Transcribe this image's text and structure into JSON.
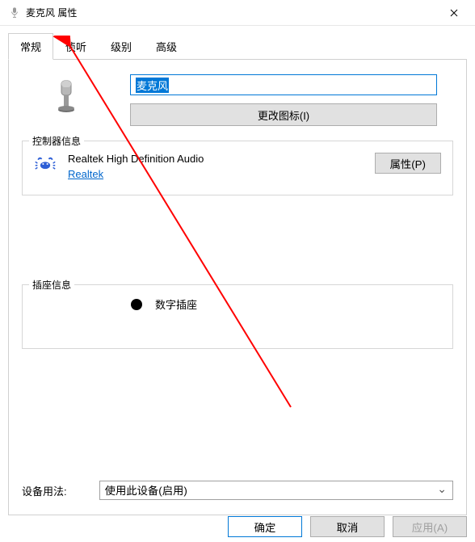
{
  "title": "麦克风 属性",
  "tabs": [
    {
      "label": "常规",
      "active": true
    },
    {
      "label": "侦听",
      "active": false
    },
    {
      "label": "级别",
      "active": false
    },
    {
      "label": "高级",
      "active": false
    }
  ],
  "general": {
    "device_name": "麦克风",
    "change_icon_label": "更改图标(I)",
    "controller_group_title": "控制器信息",
    "controller_name": "Realtek High Definition Audio",
    "vendor_name": "Realtek",
    "properties_button_label": "属性(P)",
    "jack_group_title": "插座信息",
    "jack_label": "数字插座",
    "jack_color": "#000000",
    "usage_label": "设备用法:",
    "usage_options": [
      "使用此设备(启用)"
    ],
    "usage_selected": "使用此设备(启用)"
  },
  "buttons": {
    "ok": "确定",
    "cancel": "取消",
    "apply": "应用(A)"
  },
  "annotation": {
    "arrow_color": "#ff0000"
  }
}
